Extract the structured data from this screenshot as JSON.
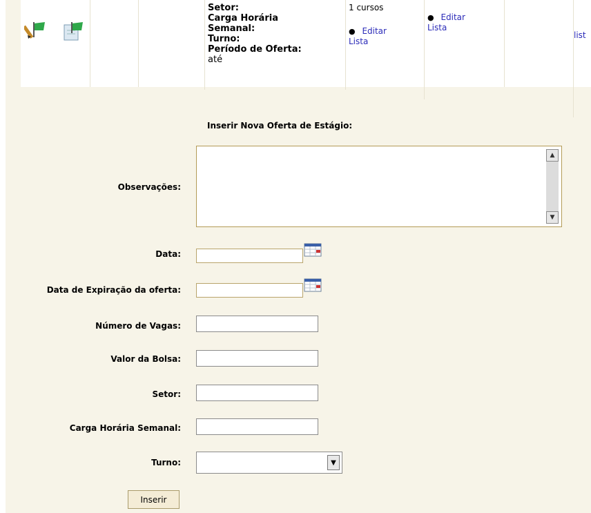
{
  "table_row": {
    "info_labels": {
      "setor": "Setor:",
      "carga_horaria_a": "Carga Horária",
      "carga_horaria_b": "Semanal:",
      "turno": "Turno:",
      "periodo": "Período de Oferta:",
      "ate": "até"
    },
    "cursos": "1 cursos",
    "editar": "Editar",
    "lista": "Lista",
    "lista_truncated": "list"
  },
  "form": {
    "title": "Inserir Nova Oferta de Estágio:",
    "labels": {
      "observacoes": "Observações:",
      "data": "Data:",
      "data_expiracao": "Data de Expiração da oferta:",
      "numero_vagas": "Número de Vagas:",
      "valor_bolsa": "Valor da Bolsa:",
      "setor": "Setor:",
      "carga_horaria": "Carga Horária Semanal:",
      "turno": "Turno:"
    },
    "values": {
      "observacoes": "",
      "data": "",
      "data_expiracao": "",
      "numero_vagas": "",
      "valor_bolsa": "",
      "setor": "",
      "carga_horaria": "",
      "turno": ""
    },
    "submit_label": "Inserir"
  },
  "colors": {
    "panel_bg": "#f7f4e8",
    "link": "#2a2ab8"
  },
  "icons": {
    "edit": "pencil-flag-icon",
    "document": "document-flag-icon",
    "calendar": "calendar-icon"
  }
}
